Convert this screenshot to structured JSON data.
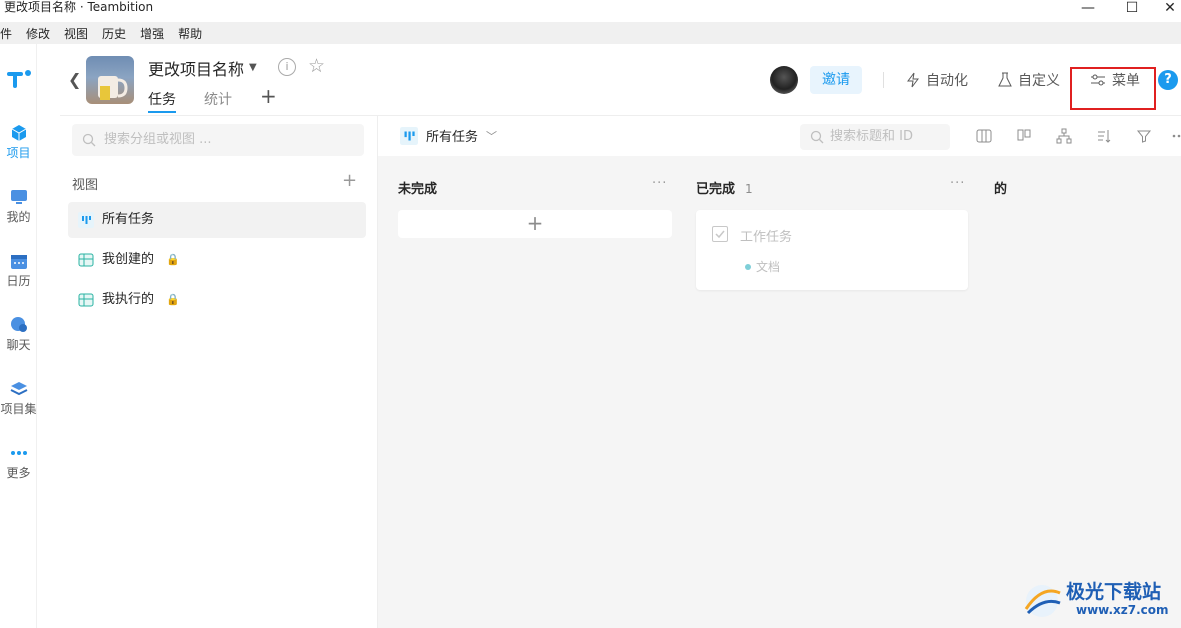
{
  "window": {
    "title": "更改项目名称 · Teambition"
  },
  "menu": [
    "件",
    "修改",
    "视图",
    "历史",
    "增强",
    "帮助"
  ],
  "rail": {
    "items": [
      {
        "label": "项目"
      },
      {
        "label": "我的"
      },
      {
        "label": "日历"
      },
      {
        "label": "聊天"
      },
      {
        "label": "项目集"
      },
      {
        "label": "更多"
      }
    ]
  },
  "header": {
    "project_name": "更改项目名称",
    "tabs": [
      {
        "label": "任务"
      },
      {
        "label": "统计"
      }
    ],
    "invite": "邀请",
    "automation": "自动化",
    "customize": "自定义",
    "menu": "菜单",
    "help": "?"
  },
  "sidebar": {
    "search_placeholder": "搜索分组或视图 ...",
    "views_label": "视图",
    "views": [
      {
        "label": "所有任务"
      },
      {
        "label": "我创建的"
      },
      {
        "label": "我执行的"
      }
    ]
  },
  "main": {
    "current_view": "所有任务",
    "search_placeholder": "搜索标题和 ID",
    "columns": [
      {
        "title": "未完成",
        "count": ""
      },
      {
        "title": "已完成",
        "count": "1"
      },
      {
        "title": "的",
        "count": ""
      }
    ],
    "task": {
      "title": "工作任务",
      "tag": "文档"
    }
  },
  "watermark": {
    "name": "极光下载站",
    "url": "www.xz7.com"
  },
  "colors": {
    "accent": "#1b9aee",
    "highlight_box": "#e02020"
  }
}
